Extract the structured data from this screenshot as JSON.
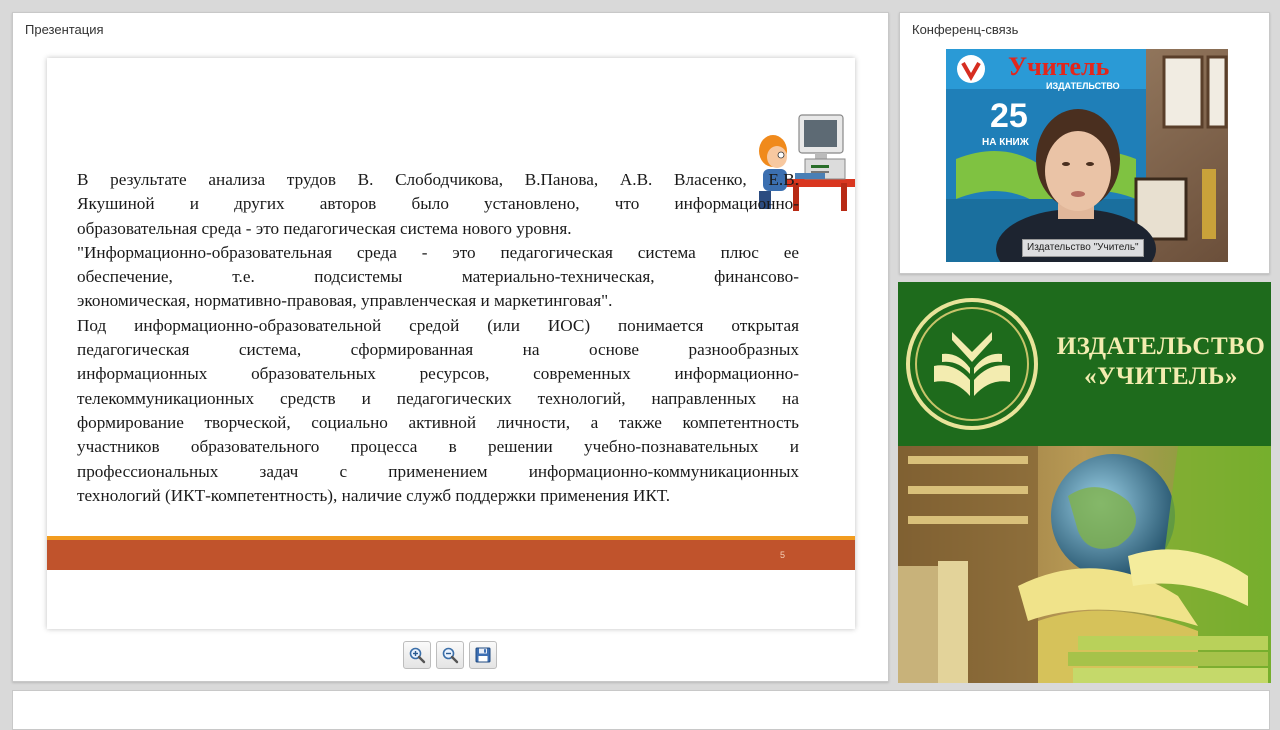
{
  "presentation": {
    "title": "Презентация",
    "slide": {
      "paragraphs": [
        "В результате анализа трудов В. Слободчикова, В.Панова, А.В. Власенко, Е.В.",
        "Якушиной и других авторов было установлено, что информационно-",
        "образовательная среда - это педагогическая система нового уровня.",
        "\"Информационно-образовательная среда - это педагогическая система плюс ее",
        "обеспечение, т.е. подсистемы материально-техническая, финансово-",
        "экономическая, нормативно-правовая, управленческая и маркетинговая\".",
        "Под информационно-образовательной средой (или ИОС) понимается открытая",
        "педагогическая система, сформированная на основе разнообразных",
        "информационных образовательных ресурсов, современных информационно-",
        "телекоммуникационных средств и педагогических технологий, направленных на",
        "формирование творческой, социально активной личности, а также компетентность",
        "участников образовательного процесса в решении учебно-познавательных и",
        "профессиональных задач с применением информационно-коммуникационных",
        "технологий (ИКТ-компетентность), наличие служб поддержки применения ИКТ."
      ],
      "page_number": "5"
    },
    "toolbar": [
      "zoom-in-icon",
      "zoom-out-icon",
      "save-icon"
    ]
  },
  "conference": {
    "title": "Конференц-связь",
    "video_label": "Издательство \"Учитель\"",
    "poster": {
      "brand": "Учитель",
      "sub": "ИЗДАТЕЛЬСТВО",
      "number": "25",
      "tagline": "НА КНИЖ"
    }
  },
  "banner": {
    "line1": "ИЗДАТЕЛЬСТВО",
    "line2": "«УЧИТЕЛЬ»"
  },
  "colors": {
    "slide_bar": "#c0532c",
    "slide_bar_accent": "#f29c1f",
    "banner_green": "#1e6b1c",
    "banner_text": "#f3ecb0"
  }
}
